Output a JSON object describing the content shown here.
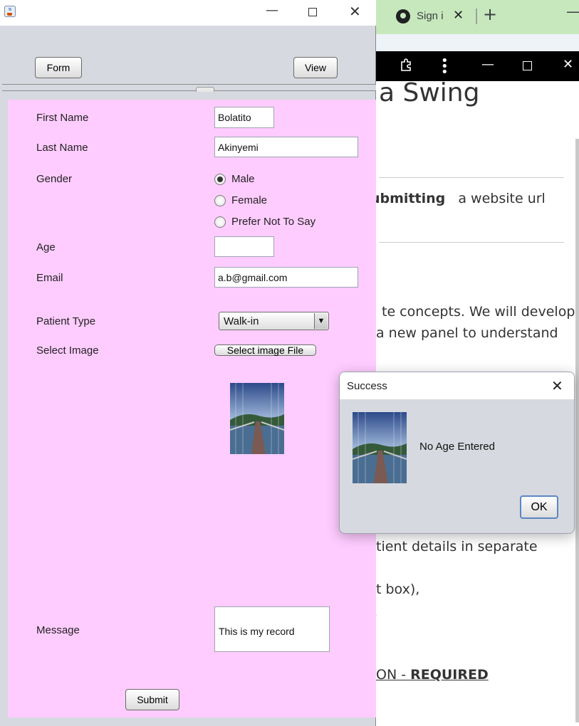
{
  "browser": {
    "tab_title": "Sign i",
    "tab_close": "✕",
    "new_tab": "+",
    "minimize": "—",
    "address_partial": "",
    "content": {
      "heading": "a Swing",
      "submit_line_bold": "ubmitting",
      "submit_line_rest": "a website url",
      "line1": "te concepts. We will develop",
      "line2": "a new panel to understand",
      "line3": "tient details in separate",
      "line4": "t box),",
      "line5": ",",
      "required_prefix": "ON - ",
      "required_bold": "REQUIRED"
    }
  },
  "window": {
    "minimize": "—",
    "close": "✕"
  },
  "toolbar": {
    "form_label": "Form",
    "view_label": "View"
  },
  "form": {
    "first_name_label": "First Name",
    "first_name_value": "Bolatito",
    "last_name_label": "Last Name",
    "last_name_value": "Akinyemi",
    "gender_label": "Gender",
    "gender_options": [
      "Male",
      "Female",
      "Prefer Not To Say"
    ],
    "gender_selected": "Male",
    "age_label": "Age",
    "age_value": "",
    "email_label": "Email",
    "email_value": "a.b@gmail.com",
    "patient_type_label": "Patient Type",
    "patient_type_value": "Walk-in",
    "select_image_label": "Select Image",
    "select_image_button": "Select image File",
    "message_label": "Message",
    "message_value": "This is my record",
    "submit_label": "Submit"
  },
  "dialog": {
    "title": "Success",
    "close": "✕",
    "message": "No Age Entered",
    "ok_label": "OK"
  },
  "colors": {
    "form_panel_bg": "#ffccff",
    "window_bg": "#d6d9df",
    "browser_tab_bg": "#c7e8bd",
    "ok_border": "#5b87c4"
  }
}
